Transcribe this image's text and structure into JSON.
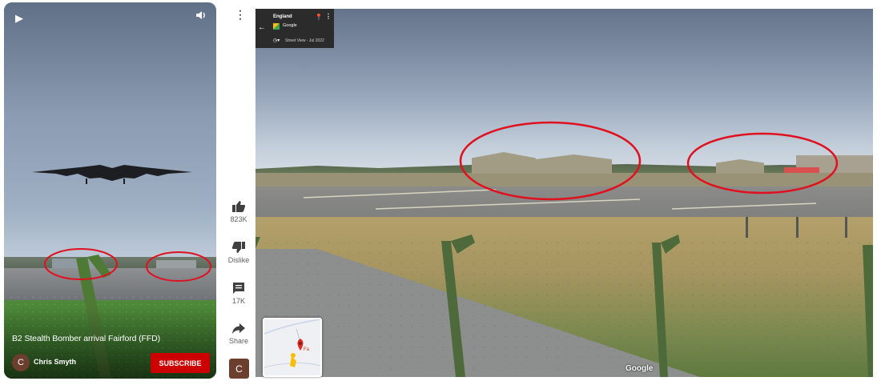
{
  "short": {
    "title": "B2 Stealth Bomber arrival Fairford (FFD)",
    "channel_initial": "C",
    "channel_name": "Chris Smyth",
    "subscribe_label": "SUBSCRIBE"
  },
  "actions": {
    "like_count": "823K",
    "dislike_label": "Dislike",
    "comment_count": "17K",
    "share_label": "Share",
    "avatar_initial": "C"
  },
  "streetview": {
    "place": "England",
    "vendor": "Google",
    "date": "Street View - Jul 2022",
    "watermark": "Google",
    "minimap_label": "Fa"
  },
  "colors": {
    "subscribe": "#cc0000",
    "annotation": "#e0101e",
    "avatar": "#6b3e2e"
  }
}
